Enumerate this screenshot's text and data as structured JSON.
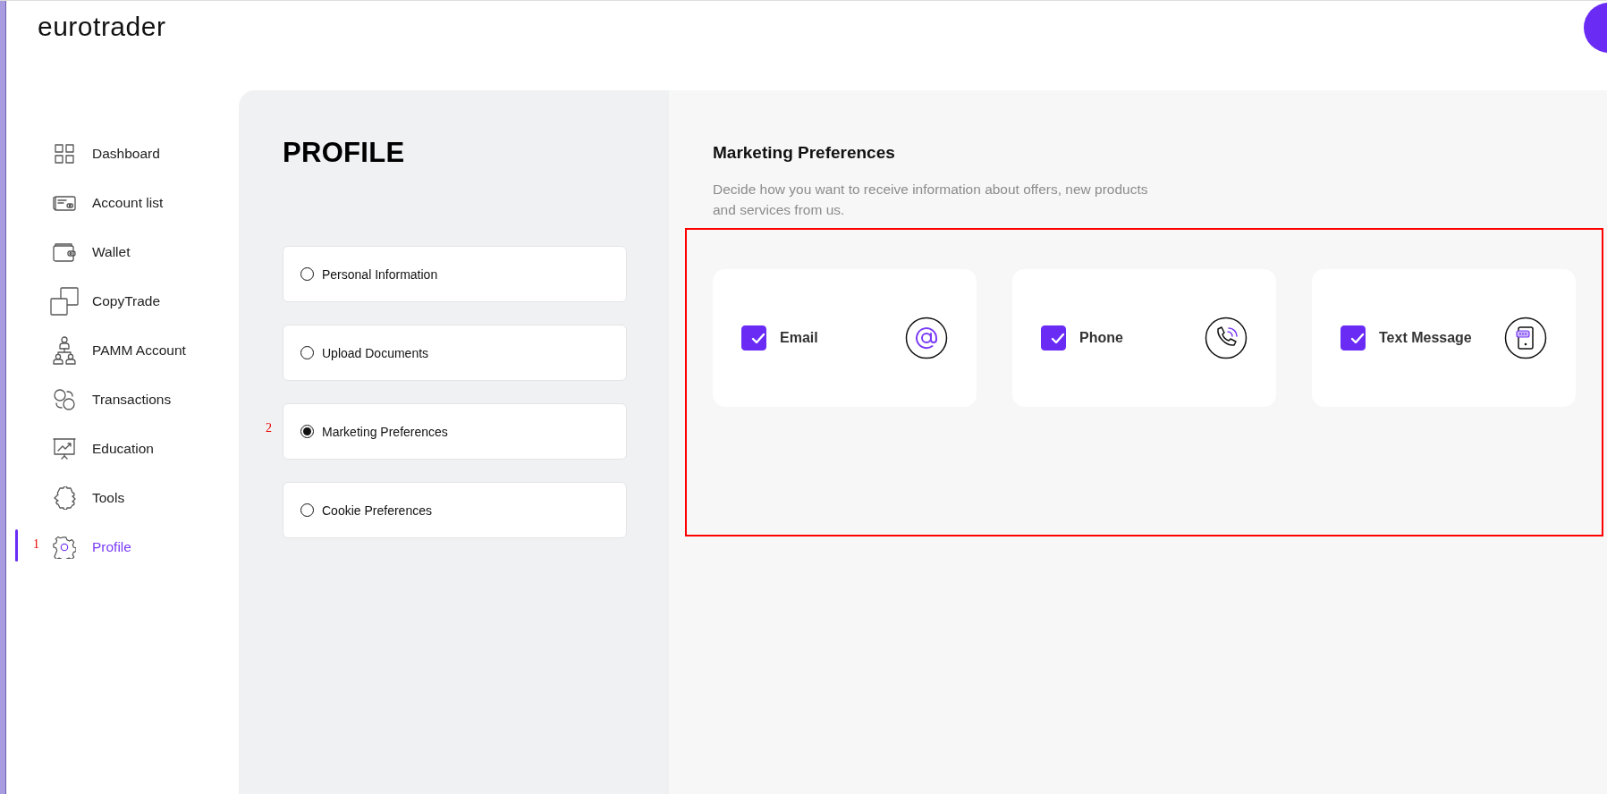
{
  "logo": "eurotrader",
  "sidebar": {
    "items": [
      {
        "label": "Dashboard",
        "selected": false
      },
      {
        "label": "Account list",
        "selected": false
      },
      {
        "label": "Wallet",
        "selected": false
      },
      {
        "label": "CopyTrade",
        "selected": false
      },
      {
        "label": "PAMM Account",
        "selected": false
      },
      {
        "label": "Transactions",
        "selected": false
      },
      {
        "label": "Education",
        "selected": false
      },
      {
        "label": "Tools",
        "selected": false
      },
      {
        "label": "Profile",
        "selected": true,
        "marker": "1"
      }
    ]
  },
  "profile": {
    "title": "PROFILE",
    "options": [
      {
        "label": "Personal Information",
        "selected": false
      },
      {
        "label": "Upload Documents",
        "selected": false
      },
      {
        "label": "Marketing Preferences",
        "selected": true,
        "marker": "2"
      },
      {
        "label": "Cookie Preferences",
        "selected": false
      }
    ]
  },
  "marketing": {
    "heading": "Marketing Preferences",
    "description": "Decide how you want to receive information about offers, new products and services from us.",
    "highlighted": true,
    "channels": [
      {
        "label": "Email",
        "checked": true
      },
      {
        "label": "Phone",
        "checked": true
      },
      {
        "label": "Text Message",
        "checked": true
      }
    ]
  }
}
